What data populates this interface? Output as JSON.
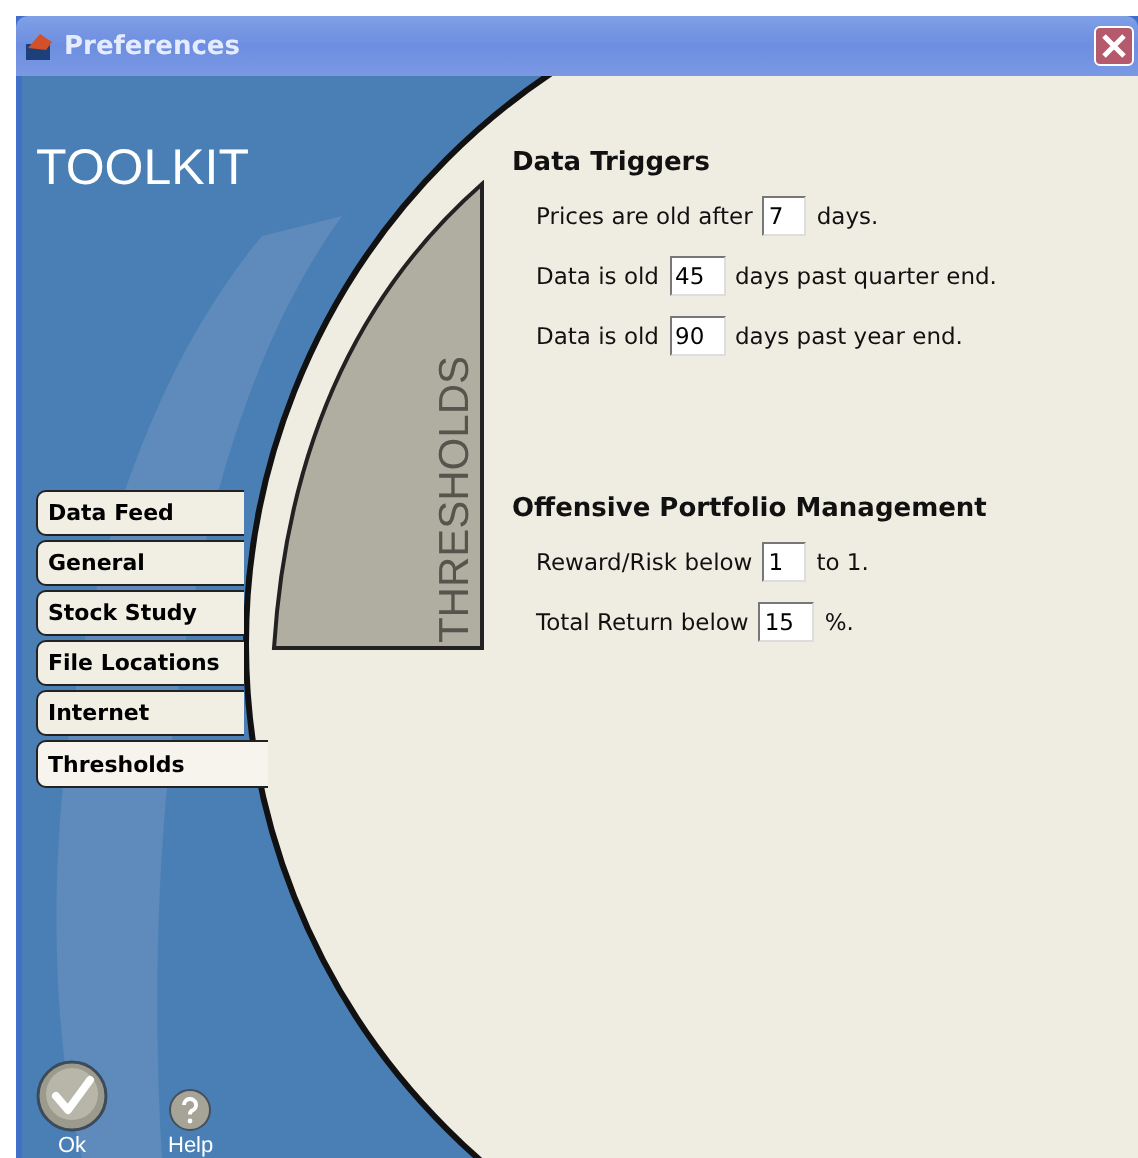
{
  "window": {
    "title": "Preferences"
  },
  "brand": "TOOLKIT",
  "banner": "THRESHOLDS",
  "tabs": [
    {
      "label": "Data Feed",
      "selected": false
    },
    {
      "label": "General",
      "selected": false
    },
    {
      "label": "Stock Study",
      "selected": false
    },
    {
      "label": "File Locations",
      "selected": false
    },
    {
      "label": "Internet",
      "selected": false
    },
    {
      "label": "Thresholds",
      "selected": true
    }
  ],
  "sections": [
    {
      "title": "Data Triggers",
      "rows": [
        {
          "before": "Prices are old after",
          "value": "7",
          "after": "days."
        },
        {
          "before": "Data is old",
          "value": "45",
          "after": "days past quarter end."
        },
        {
          "before": "Data is old",
          "value": "90",
          "after": "days past year end."
        }
      ]
    },
    {
      "title": "Offensive Portfolio Management",
      "rows": [
        {
          "before": "Reward/Risk below",
          "value": "1",
          "after": "to 1."
        },
        {
          "before": "Total Return below",
          "value": "15",
          "after": "%."
        }
      ]
    }
  ],
  "buttons": [
    {
      "label": "Ok",
      "kind": "ok"
    },
    {
      "label": "Help",
      "kind": "help"
    }
  ]
}
